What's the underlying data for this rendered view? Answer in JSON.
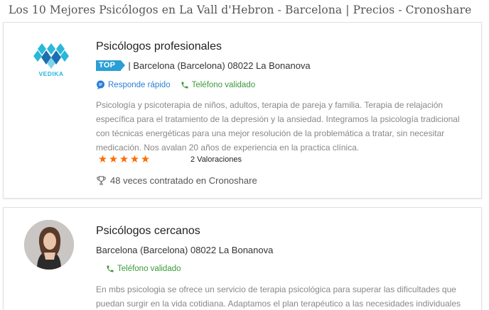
{
  "page": {
    "title": "Los 10 Mejores Psicólogos en La Vall d'Hebron - Barcelona | Precios - Cronoshare"
  },
  "results": [
    {
      "logo_text": "VEDIKA",
      "name": "Psicólogos profesionales",
      "badge": "TOP",
      "address": "| Barcelona (Barcelona) 08022 La Bonanova",
      "tag_fast": "Responde rápido",
      "tag_phone": "Teléfono validado",
      "description": "Psicología y psicoterapia de niños, adultos, terapia de pareja y familia. Terapia de relajación específica para el tratamiento de la depresión y la ansiedad. Integramos la psicología tradicional con técnicas energéticas para una mejor resolución de la problemática a tratar, sin necesitar medicación. Nos avalan 20 años de experiencia en la practica clínica.",
      "stars": "★★★★★",
      "rating_value": 5,
      "reviews": "2 Valoraciones",
      "hired": "48 veces contratado en Cronoshare"
    },
    {
      "name": "Psicólogos cercanos",
      "address": "Barcelona (Barcelona) 08022 La Bonanova",
      "tag_phone": "Teléfono validado",
      "description": "En mbs psicologia se ofrece un servicio de terapia psicológica para superar las dificultades que puedan surgir en la vida cotidiana. Adaptamos el plan terapéutico a las necesidades individuales"
    }
  ],
  "colors": {
    "top_badge": "#2a9fd6",
    "stars": "#ff6a00",
    "fast_tag": "#2a7fd6",
    "phone_tag": "#3a9a3a"
  },
  "icons": {
    "fast": "chat-bubble-icon",
    "phone": "phone-icon",
    "hired": "trophy-icon"
  }
}
